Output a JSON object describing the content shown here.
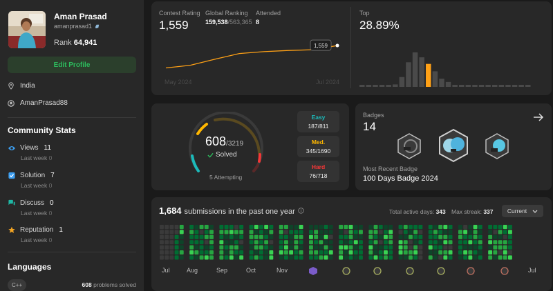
{
  "profile": {
    "name": "Aman Prasad",
    "handle": "amanprasad1",
    "rank_label": "Rank",
    "rank_value": "64,941",
    "edit_label": "Edit Profile",
    "location": "India",
    "github": "AmanPrasad88"
  },
  "community": {
    "title": "Community Stats",
    "items": [
      {
        "label": "Views",
        "value": "11",
        "sub": "Last week",
        "sub_value": "0",
        "color": "#3c9ef0"
      },
      {
        "label": "Solution",
        "value": "7",
        "sub": "Last week",
        "sub_value": "0",
        "color": "#3c9ef0"
      },
      {
        "label": "Discuss",
        "value": "0",
        "sub": "Last week",
        "sub_value": "0",
        "color": "#1fb7a5"
      },
      {
        "label": "Reputation",
        "value": "1",
        "sub": "Last week",
        "sub_value": "0",
        "color": "#f4a523"
      }
    ]
  },
  "languages": {
    "title": "Languages",
    "tag": "C++",
    "count": "608",
    "count_suffix": "problems solved"
  },
  "contest": {
    "rating_label": "Contest Rating",
    "rating": "1,559",
    "global_label": "Global Ranking",
    "global_rank": "159,538",
    "global_total": "/563,365",
    "attended_label": "Attended",
    "attended": "8",
    "start_label": "May 2024",
    "end_label": "Jul 2024",
    "tooltip": "1,559",
    "top_label": "Top",
    "top_value": "28.89%"
  },
  "chart_data": [
    {
      "type": "line",
      "x": [
        "May 2024",
        "",
        "",
        "",
        "",
        "",
        "",
        "Jul 2024"
      ],
      "values": [
        1500,
        1507,
        1523,
        1538,
        1543,
        1546,
        1548,
        1559
      ],
      "xlabel": "",
      "ylabel": "",
      "ylim": [
        1490,
        1570
      ]
    },
    {
      "type": "bar",
      "categories": [
        "1",
        "2",
        "3",
        "4",
        "5",
        "6",
        "7",
        "8",
        "9",
        "10",
        "11",
        "12",
        "13",
        "14",
        "15",
        "16",
        "17",
        "18",
        "19",
        "20",
        "21",
        "22",
        "23",
        "24",
        "25",
        "26"
      ],
      "values": [
        1,
        1,
        1,
        1,
        1,
        3,
        12,
        30,
        42,
        36,
        28,
        19,
        10,
        6,
        2,
        1,
        1,
        1,
        1,
        1,
        1,
        1,
        1,
        1,
        1,
        1
      ],
      "highlight_index": 10,
      "highlight_color": "#ffa116"
    }
  ],
  "solved": {
    "value": "608",
    "total": "/3219",
    "label": "Solved",
    "attempting": "5 Attempting",
    "easy_label": "Easy",
    "easy": "187/811",
    "med_label": "Med.",
    "med": "345/1690",
    "hard_label": "Hard",
    "hard": "76/718",
    "easy_color": "#1cbaba",
    "med_color": "#ffb700",
    "hard_color": "#f63737"
  },
  "badges": {
    "label": "Badges",
    "count": "14",
    "recent_label": "Most Recent Badge",
    "recent": "100 Days Badge 2024"
  },
  "submissions": {
    "count": "1,684",
    "text": "submissions in the past one year",
    "active_label": "Total active days:",
    "active": "343",
    "streak_label": "Max streak:",
    "streak": "337",
    "select": "Current",
    "months": [
      "Jul",
      "Aug",
      "Sep",
      "Oct",
      "Nov",
      "Jul"
    ]
  }
}
